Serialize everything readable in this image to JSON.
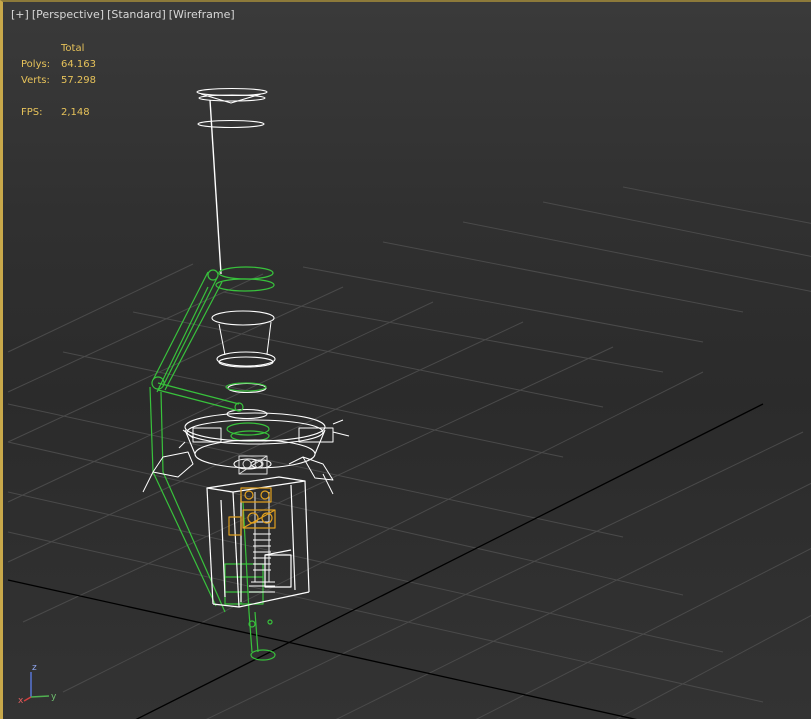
{
  "viewport": {
    "menu": {
      "plus": "[+]",
      "view": "[Perspective]",
      "shading": "[Standard]",
      "display": "[Wireframe]"
    },
    "stats": {
      "header": "Total",
      "polys_label": "Polys:",
      "polys_value": "64.163",
      "verts_label": "Verts:",
      "verts_value": "57.298",
      "fps_label": "FPS:",
      "fps_value": "2,148"
    },
    "axis_labels": {
      "x": "x",
      "y": "y",
      "z": "z"
    }
  },
  "colors": {
    "border_accent": "#c8a84a",
    "stats_text": "#e6c25a",
    "grid_line": "#4a4a4a",
    "grid_axis": "#000000",
    "wire_white": "#ffffff",
    "wire_green": "#38c23c",
    "wire_orange": "#e0a020"
  }
}
